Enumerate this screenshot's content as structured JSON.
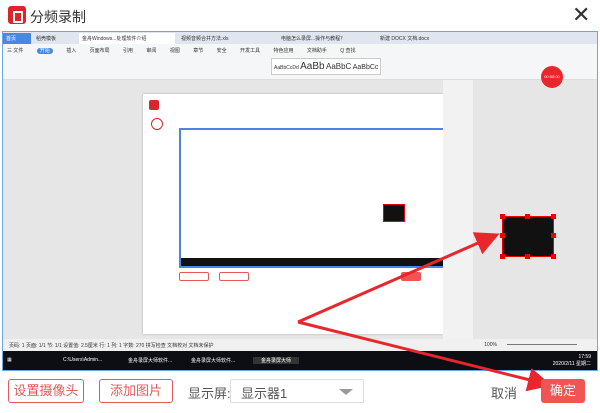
{
  "window": {
    "title": "分频录制"
  },
  "preview": {
    "tabs": [
      "首页",
      "稻壳模板",
      "金舟Windows...处理软件介绍",
      "视频音频合并方法.xls",
      "电脑怎么录屏...操作与教程？",
      "新建 DOCX 文档.docx"
    ],
    "menu": [
      "三 文件",
      "开始",
      "插入",
      "页面布局",
      "引用",
      "审阅",
      "视图",
      "章节",
      "安全",
      "开发工具",
      "特色应用",
      "文档助手",
      "Q 查找"
    ],
    "styles": [
      "AaBbCcDd",
      "AaBb",
      "AaBbC",
      "AaBbCc"
    ],
    "record_badge": "00:00:00",
    "statusbar": "页码: 1  页面: 1/1  节: 1/1  设置值: 2.5厘米  行: 1  列: 1  字数: 270  拼写检查  文档校对  文档未保护",
    "zoom": "100%",
    "taskbar": [
      "C:\\Users\\Admin...",
      "金舟录屏大师软件...",
      "金舟录屏大师软件...",
      "金舟录屏大师"
    ],
    "clock_time": "17:59",
    "clock_date": "2020/2/11 星期二"
  },
  "footer": {
    "camera_button": "设置摄像头",
    "image_button": "添加图片",
    "display_label": "显示屏:",
    "display_value": "显示器1",
    "cancel": "取消",
    "confirm": "确定"
  },
  "colors": {
    "accent": "#f05454",
    "arrow": "#e8262c"
  }
}
